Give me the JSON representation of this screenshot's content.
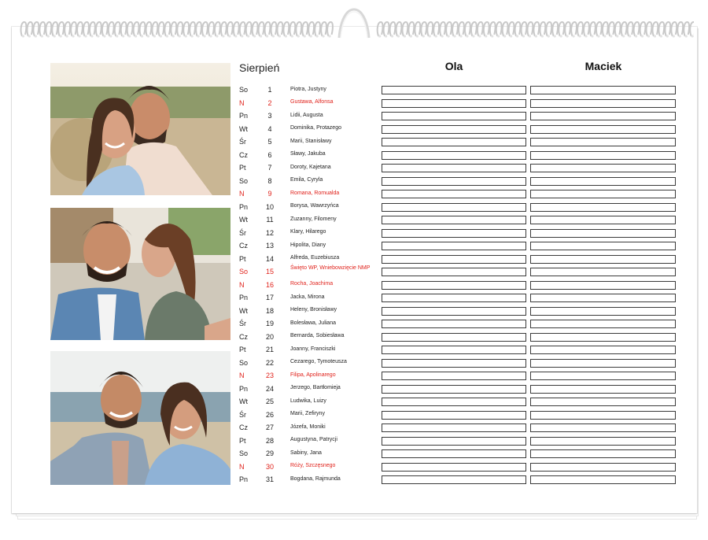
{
  "calendar": {
    "month": "Sierpień",
    "people": [
      "Ola",
      "Maciek"
    ],
    "colors": {
      "holiday": "#e0221b",
      "text": "#222222",
      "box_border": "#3a3a3a"
    },
    "days": [
      {
        "dow": "So",
        "day": "1",
        "names": "Piotra, Justyny",
        "holiday": false
      },
      {
        "dow": "N",
        "day": "2",
        "names": "Gustawa, Alfonsa",
        "holiday": true
      },
      {
        "dow": "Pn",
        "day": "3",
        "names": "Lidii, Augusta",
        "holiday": false
      },
      {
        "dow": "Wt",
        "day": "4",
        "names": "Dominika, Protazego",
        "holiday": false
      },
      {
        "dow": "Śr",
        "day": "5",
        "names": "Marii, Stanisławy",
        "holiday": false
      },
      {
        "dow": "Cz",
        "day": "6",
        "names": "Sławy, Jakuba",
        "holiday": false
      },
      {
        "dow": "Pt",
        "day": "7",
        "names": "Doroty, Kajetana",
        "holiday": false
      },
      {
        "dow": "So",
        "day": "8",
        "names": "Emila, Cyryla",
        "holiday": false
      },
      {
        "dow": "N",
        "day": "9",
        "names": "Romana, Romualda",
        "holiday": true
      },
      {
        "dow": "Pn",
        "day": "10",
        "names": "Borysa, Wawrzyńca",
        "holiday": false
      },
      {
        "dow": "Wt",
        "day": "11",
        "names": "Zuzanny, Filomeny",
        "holiday": false
      },
      {
        "dow": "Śr",
        "day": "12",
        "names": "Klary, Hilarego",
        "holiday": false
      },
      {
        "dow": "Cz",
        "day": "13",
        "names": "Hipolita, Diany",
        "holiday": false
      },
      {
        "dow": "Pt",
        "day": "14",
        "names": "Alfreda, Euzebiusza",
        "holiday": false
      },
      {
        "dow": "So",
        "day": "15",
        "names": "Święto WP, Wniebowzięcie NMP",
        "holiday": true
      },
      {
        "dow": "N",
        "day": "16",
        "names": "Rocha, Joachima",
        "holiday": true
      },
      {
        "dow": "Pn",
        "day": "17",
        "names": "Jacka, Mirona",
        "holiday": false
      },
      {
        "dow": "Wt",
        "day": "18",
        "names": "Heleny, Bronisławy",
        "holiday": false
      },
      {
        "dow": "Śr",
        "day": "19",
        "names": "Bolesława, Juliana",
        "holiday": false
      },
      {
        "dow": "Cz",
        "day": "20",
        "names": "Bernarda, Sobiesława",
        "holiday": false
      },
      {
        "dow": "Pt",
        "day": "21",
        "names": "Joanny, Franciszki",
        "holiday": false
      },
      {
        "dow": "So",
        "day": "22",
        "names": "Cezarego, Tymoteusza",
        "holiday": false
      },
      {
        "dow": "N",
        "day": "23",
        "names": "Filipa, Apolinarego",
        "holiday": true
      },
      {
        "dow": "Pn",
        "day": "24",
        "names": "Jerzego, Bartłomieja",
        "holiday": false
      },
      {
        "dow": "Wt",
        "day": "25",
        "names": "Ludwika, Luizy",
        "holiday": false
      },
      {
        "dow": "Śr",
        "day": "26",
        "names": "Marii, Zefiryny",
        "holiday": false
      },
      {
        "dow": "Cz",
        "day": "27",
        "names": "Józefa, Moniki",
        "holiday": false
      },
      {
        "dow": "Pt",
        "day": "28",
        "names": "Augustyna, Patrycji",
        "holiday": false
      },
      {
        "dow": "So",
        "day": "29",
        "names": "Sabiny, Jana",
        "holiday": false
      },
      {
        "dow": "N",
        "day": "30",
        "names": "Róży, Szczęsnego",
        "holiday": true
      },
      {
        "dow": "Pn",
        "day": "31",
        "names": "Bogdana, Rajmunda",
        "holiday": false
      }
    ]
  },
  "photos": [
    {
      "icon": "couple-photo-sunset"
    },
    {
      "icon": "couple-photo-kiss-selfie"
    },
    {
      "icon": "couple-photo-beach-selfie"
    }
  ]
}
